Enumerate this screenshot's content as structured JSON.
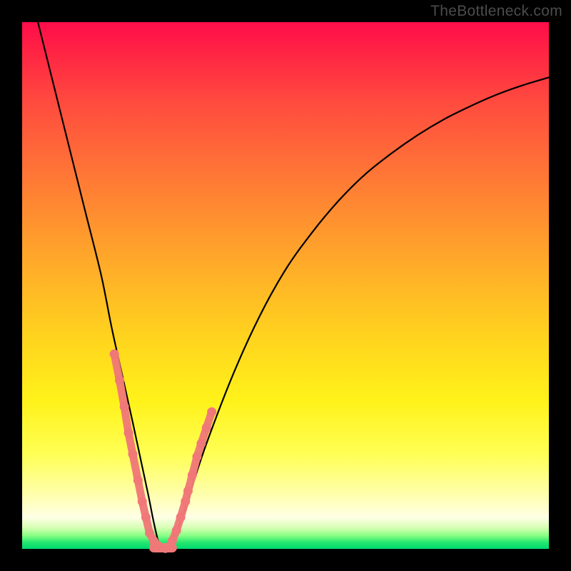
{
  "watermark": "TheBottleneck.com",
  "chart_data": {
    "type": "line",
    "title": "",
    "xlabel": "",
    "ylabel": "",
    "xlim": [
      0,
      100
    ],
    "ylim": [
      0,
      100
    ],
    "series": [
      {
        "name": "bottleneck-curve",
        "x": [
          3,
          6,
          9,
          12,
          15,
          17,
          19,
          21,
          22.5,
          24,
          25,
          26,
          27,
          28,
          30,
          32,
          35,
          40,
          45,
          50,
          55,
          60,
          65,
          70,
          75,
          80,
          85,
          90,
          95,
          100
        ],
        "y": [
          100,
          88,
          76,
          64,
          52,
          42,
          33,
          24,
          17,
          10,
          5,
          1,
          0,
          1,
          5,
          11,
          20,
          33,
          44,
          53,
          60,
          66,
          71,
          75,
          78.5,
          81.5,
          84,
          86.2,
          88,
          89.5
        ]
      }
    ],
    "markers": {
      "name": "highlighted-points",
      "color": "#f07878",
      "clusters": [
        {
          "x": [
            17.5,
            18.5,
            19.4,
            20.2,
            21.0,
            22.0,
            22.8,
            23.5,
            24.2,
            25.0,
            25.8,
            26.5,
            27.2
          ],
          "y": [
            37,
            32,
            27,
            22,
            18,
            13,
            9,
            6,
            3,
            1.5,
            0.6,
            0.2,
            0.1
          ]
        },
        {
          "x": [
            27.8,
            28.5,
            29.3,
            30.1,
            31.0,
            31.5,
            32.3,
            33.2,
            34.0,
            35.0,
            36.0
          ],
          "y": [
            0.3,
            1.5,
            3.5,
            6,
            9,
            11,
            14,
            17.5,
            20,
            23,
            26
          ]
        }
      ]
    },
    "gradient_stops": [
      {
        "pos": 0,
        "color": "#ff0d4b"
      },
      {
        "pos": 30,
        "color": "#ff7a35"
      },
      {
        "pos": 60,
        "color": "#ffd41e"
      },
      {
        "pos": 82,
        "color": "#ffff55"
      },
      {
        "pos": 96,
        "color": "#d6ffb4"
      },
      {
        "pos": 100,
        "color": "#00d870"
      }
    ]
  }
}
